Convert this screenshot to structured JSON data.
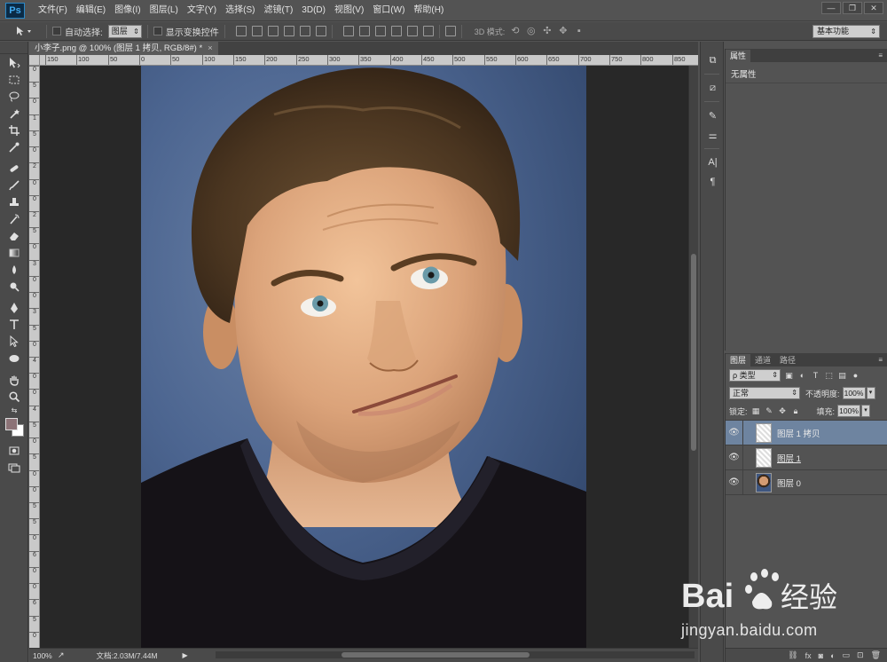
{
  "app": {
    "logo": "Ps",
    "menu": [
      "文件(F)",
      "编辑(E)",
      "图像(I)",
      "图层(L)",
      "文字(Y)",
      "选择(S)",
      "滤镜(T)",
      "3D(D)",
      "视图(V)",
      "窗口(W)",
      "帮助(H)"
    ],
    "window_controls": [
      "minimize-icon",
      "restore-icon",
      "close-icon"
    ]
  },
  "options_bar": {
    "auto_select_label": "自动选择:",
    "auto_select_target": "图层",
    "show_transform_label": "显示变换控件",
    "mode_3d_label": "3D 模式:",
    "workspace": "基本功能"
  },
  "document": {
    "tab_title": "小李子.png @ 100% (图层 1 拷贝, RGB/8#) *",
    "close": "×"
  },
  "ruler": {
    "h_labels": [
      "150",
      "100",
      "50",
      "0",
      "50",
      "100",
      "150",
      "200",
      "250",
      "300",
      "350",
      "400",
      "450",
      "500",
      "550",
      "600",
      "650",
      "700",
      "750",
      "800",
      "850"
    ],
    "v_labels": [
      "0",
      "5",
      "0",
      "1",
      "5",
      "0",
      "2",
      "0",
      "0",
      "2",
      "5",
      "0",
      "3",
      "0",
      "0",
      "3",
      "5",
      "0",
      "4",
      "0",
      "0",
      "4",
      "5",
      "0",
      "5",
      "0",
      "0",
      "5",
      "5",
      "0",
      "6",
      "0",
      "0",
      "6",
      "5",
      "0"
    ]
  },
  "status_bar": {
    "zoom": "100%",
    "doc_size": "文档:2.03M/7.44M",
    "arrow": "▶"
  },
  "properties_panel": {
    "tab": "属性",
    "body": "无属性"
  },
  "layers_panel": {
    "tabs": [
      "图层",
      "通道",
      "路径"
    ],
    "filter_label": "ρ 类型",
    "blend_mode": "正常",
    "opacity_label": "不透明度:",
    "opacity_value": "100%",
    "lock_label": "锁定:",
    "fill_label": "填充:",
    "fill_value": "100%",
    "layers": [
      {
        "name": "图层 1 拷贝",
        "selected": true
      },
      {
        "name": "图层 1",
        "selected": false
      },
      {
        "name": "图层 0",
        "selected": false
      }
    ],
    "footer_icons": [
      "link-icon",
      "fx-icon",
      "mask-icon",
      "adjustment-icon",
      "group-icon",
      "new-layer-icon",
      "trash-icon"
    ]
  },
  "watermark": {
    "brand": "Bai 经验",
    "url": "jingyan.baidu.com"
  }
}
